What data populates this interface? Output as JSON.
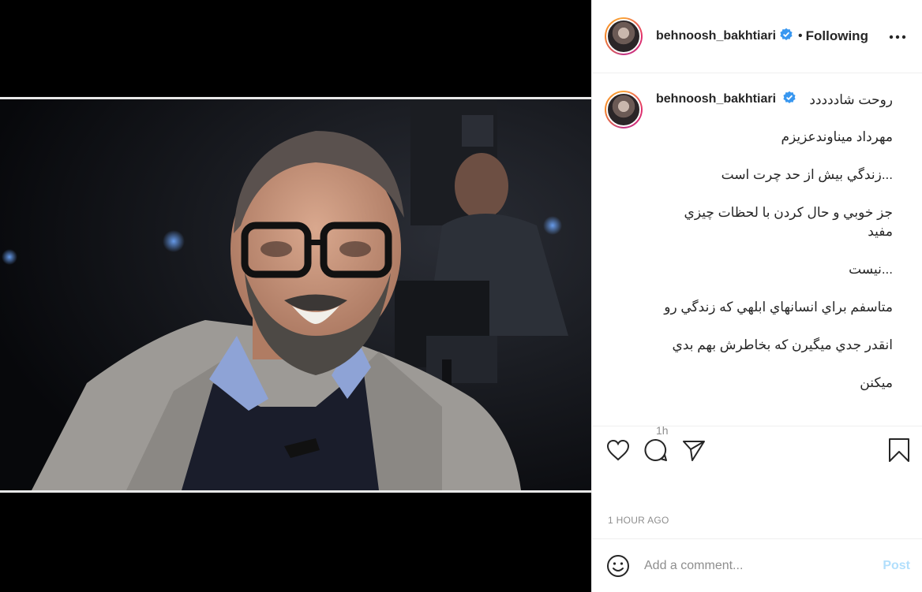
{
  "post": {
    "username": "behnoosh_bakhtiari",
    "follow_status": "Following",
    "caption": {
      "username": "behnoosh_bakhtiari",
      "first_line": "روحت شاددددد",
      "lines": [
        "مهرداد میناوندعزیزم",
        "...زندگي بيش از حد چرت است",
        "جز خوبي و حال كردن با لحظات چيزي مفيد",
        "...نيست",
        "متاسفم براي انسانهاي ابلهي كه زندگي رو",
        "انقدر جدي ميگيرن كه بخاطرش بهم بدي",
        "ميكنن"
      ],
      "time_ago": "1h"
    },
    "timestamp": "1 HOUR AGO",
    "comment_placeholder": "Add a comment...",
    "post_label": "Post"
  },
  "icons": {
    "verified": "verified-badge-icon",
    "more": "more-options-icon",
    "like": "heart-icon",
    "comment": "comment-icon",
    "share": "send-icon",
    "save": "bookmark-icon",
    "emoji": "emoji-icon"
  },
  "colors": {
    "verified_blue": "#3897f0",
    "post_button_disabled": "#b2dffc",
    "muted_text": "#8e8e8e"
  }
}
